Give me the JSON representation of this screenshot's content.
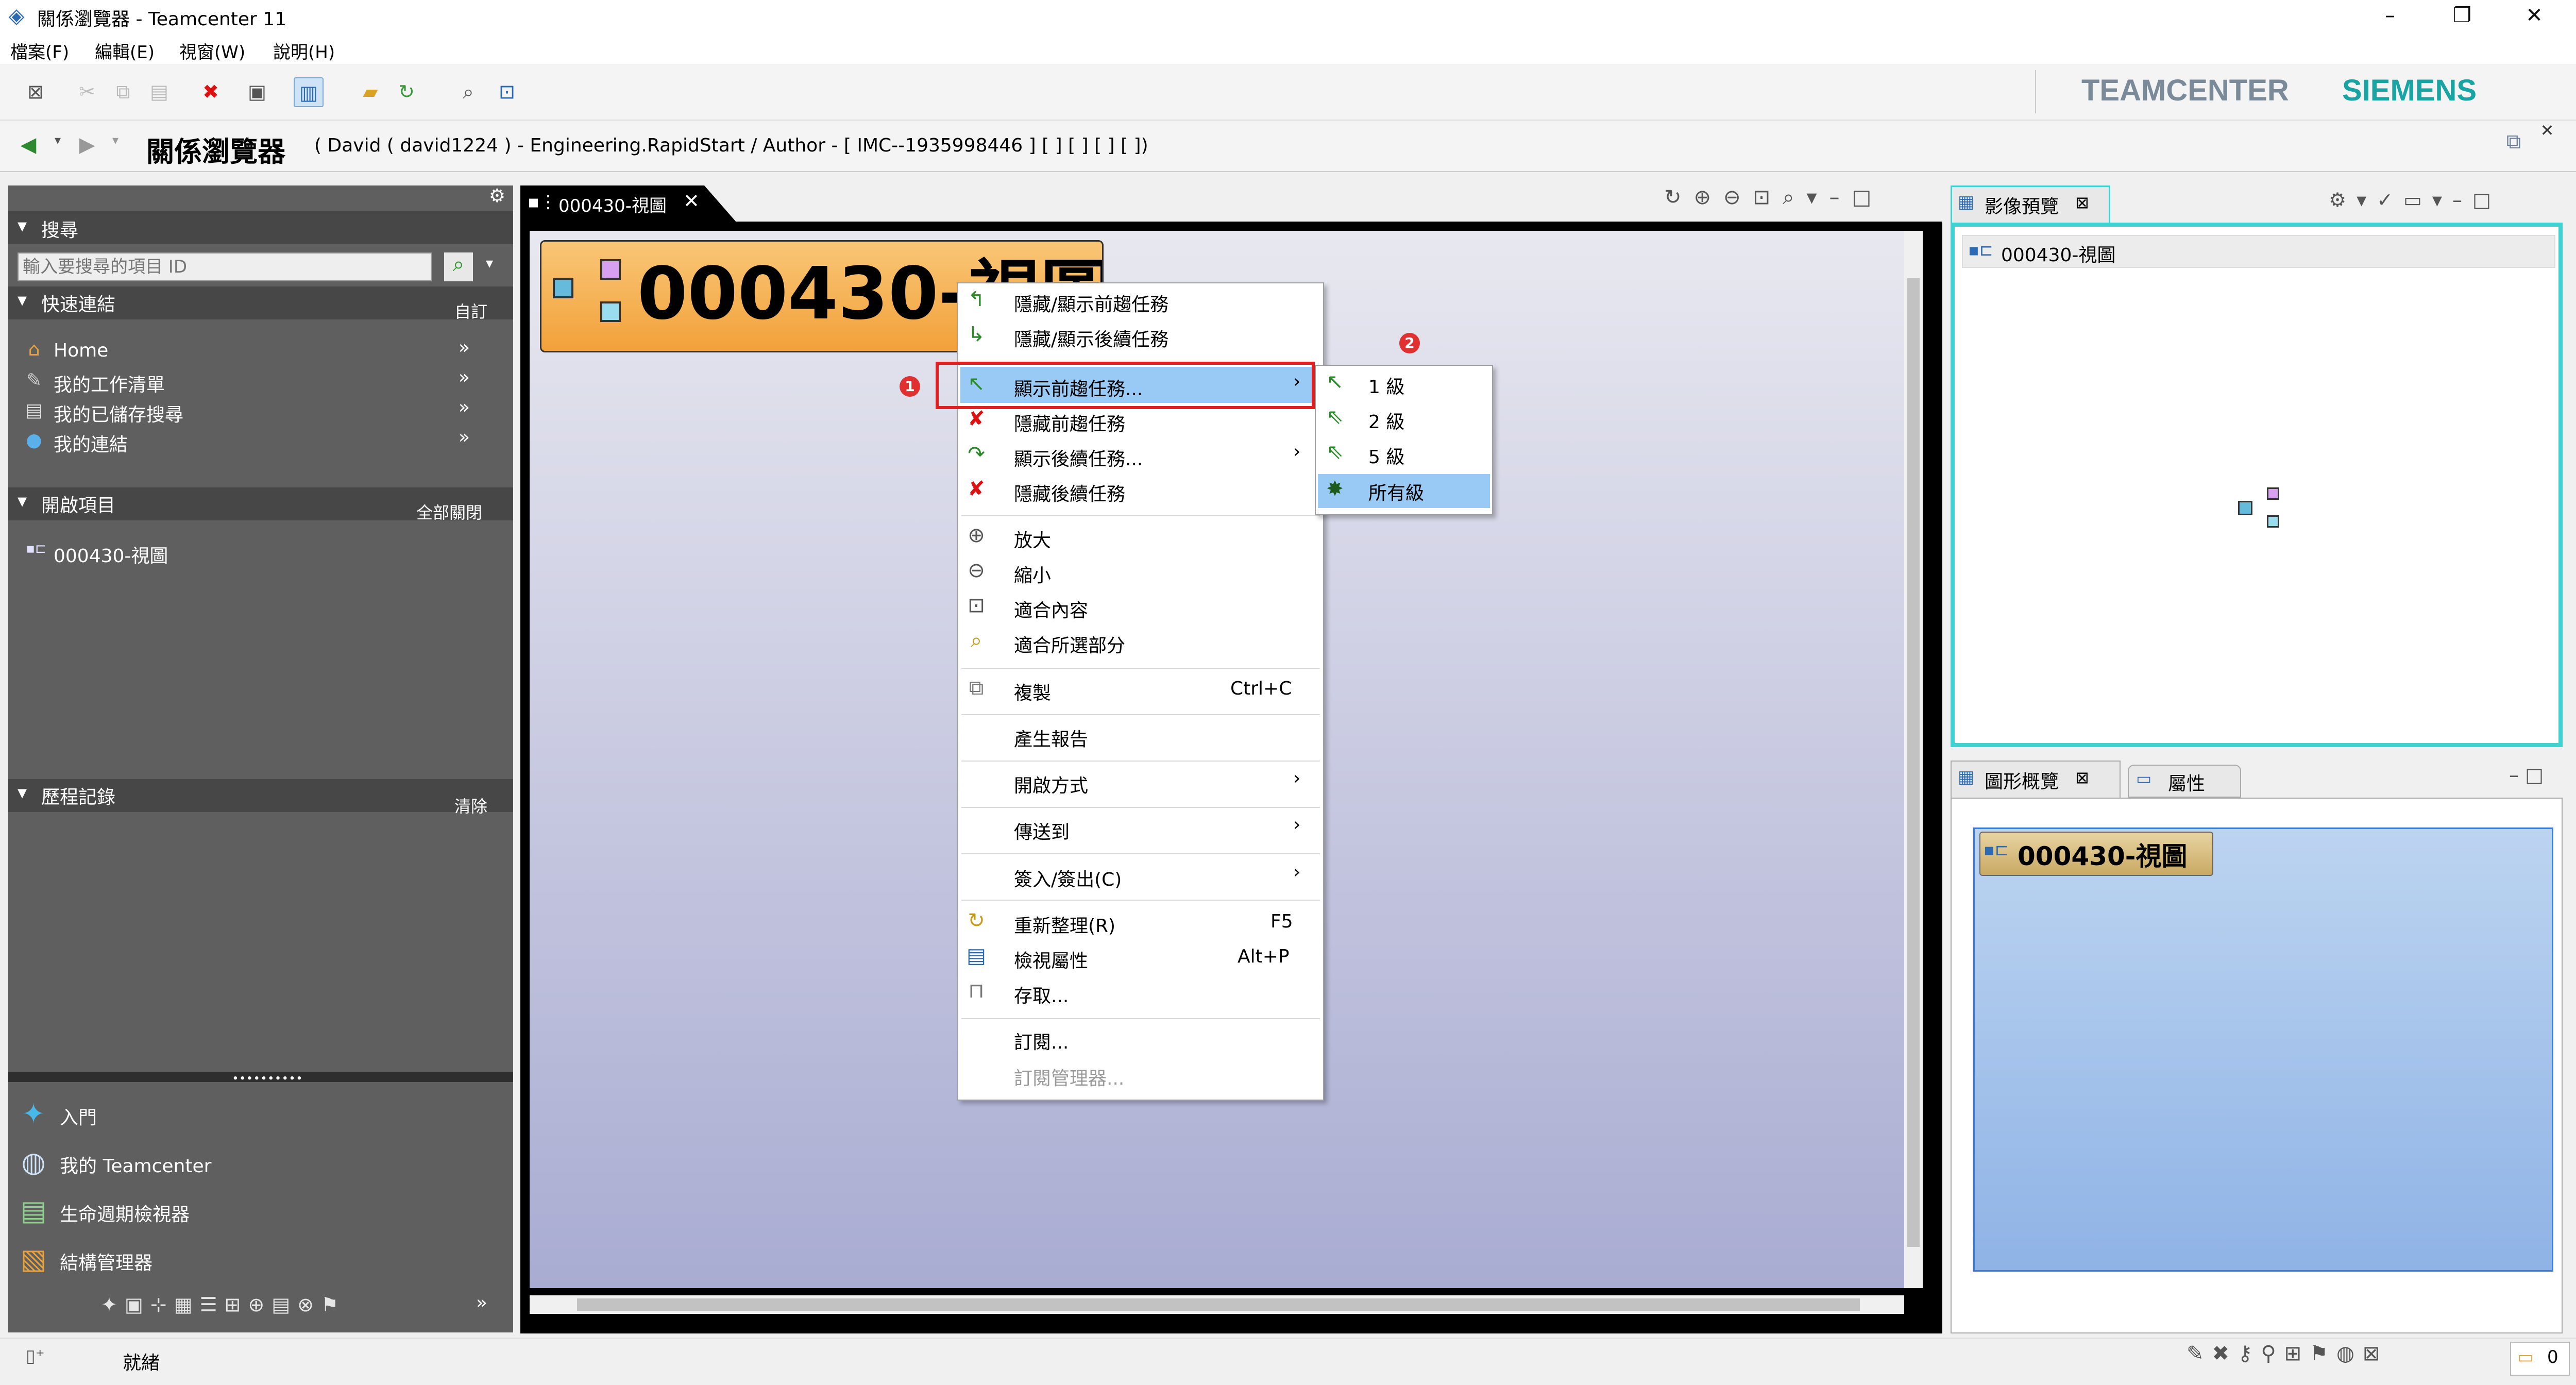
{
  "window": {
    "title": "關係瀏覽器 - Teamcenter 11",
    "minimize": "–",
    "restore": "❐",
    "close": "✕"
  },
  "menu": [
    "檔案(F)",
    "編輯(E)",
    "視窗(W)",
    "說明(H)"
  ],
  "brand": {
    "teamcenter": "TEAMCENTER",
    "siemens": "SIEMENS",
    "teamcenter_color": "#7a8a99",
    "siemens_color": "#1aa3a3"
  },
  "header": {
    "title": "關係瀏覽器",
    "context": "( David ( david1224 ) - Engineering.RapidStart / Author - [ IMC--1935998446 ] [ ] [ ] [ ] [ ])"
  },
  "left": {
    "search": {
      "title": "搜尋",
      "placeholder": "輸入要搜尋的項目 ID"
    },
    "quick": {
      "title": "快速連結",
      "action": "自訂",
      "items": [
        "Home",
        "我的工作清單",
        "我的已儲存搜尋",
        "我的連結"
      ]
    },
    "open": {
      "title": "開啟項目",
      "action": "全部關閉",
      "items": [
        "000430-視圖"
      ]
    },
    "history": {
      "title": "歷程記錄",
      "action": "清除"
    },
    "apps": [
      "入門",
      "我的 Teamcenter",
      "生命週期檢視器",
      "結構管理器"
    ]
  },
  "editor": {
    "tab": "000430-視圖",
    "node_label": "000430-視圖"
  },
  "context_menu": {
    "items": [
      {
        "icon": "hide-show-predecessor-icon",
        "label": "隱藏/顯示前趨任務",
        "shortcut": "",
        "arrow": ""
      },
      {
        "icon": "hide-show-successor-icon",
        "label": "隱藏/顯示後續任務",
        "shortcut": "",
        "arrow": ""
      },
      {
        "icon": "show-predecessor-icon",
        "label": "顯示前趨任務...",
        "shortcut": "",
        "arrow": "›"
      },
      {
        "icon": "hide-predecessor-icon",
        "label": "隱藏前趨任務",
        "shortcut": "",
        "arrow": ""
      },
      {
        "icon": "show-successor-icon",
        "label": "顯示後續任務...",
        "shortcut": "",
        "arrow": "›"
      },
      {
        "icon": "hide-successor-icon",
        "label": "隱藏後續任務",
        "shortcut": "",
        "arrow": ""
      },
      {
        "icon": "zoom-in-icon",
        "label": "放大",
        "shortcut": "",
        "arrow": ""
      },
      {
        "icon": "zoom-out-icon",
        "label": "縮小",
        "shortcut": "",
        "arrow": ""
      },
      {
        "icon": "fit-content-icon",
        "label": "適合內容",
        "shortcut": "",
        "arrow": ""
      },
      {
        "icon": "fit-selection-icon",
        "label": "適合所選部分",
        "shortcut": "",
        "arrow": ""
      },
      {
        "icon": "copy-icon",
        "label": "複製",
        "shortcut": "Ctrl+C",
        "arrow": ""
      },
      {
        "icon": "",
        "label": "產生報告",
        "shortcut": "",
        "arrow": ""
      },
      {
        "icon": "",
        "label": "開啟方式",
        "shortcut": "",
        "arrow": "›"
      },
      {
        "icon": "",
        "label": "傳送到",
        "shortcut": "",
        "arrow": "›"
      },
      {
        "icon": "",
        "label": "簽入/簽出(C)",
        "shortcut": "",
        "arrow": "›"
      },
      {
        "icon": "refresh-icon",
        "label": "重新整理(R)",
        "shortcut": "F5",
        "arrow": ""
      },
      {
        "icon": "properties-icon",
        "label": "檢視屬性",
        "shortcut": "Alt+P",
        "arrow": ""
      },
      {
        "icon": "lock-icon",
        "label": "存取...",
        "shortcut": "",
        "arrow": ""
      },
      {
        "icon": "",
        "label": "訂閱...",
        "shortcut": "",
        "arrow": ""
      },
      {
        "icon": "",
        "label": "訂閱管理器...",
        "shortcut": "",
        "arrow": ""
      }
    ]
  },
  "submenu": {
    "items": [
      "1 級",
      "2 級",
      "5 級",
      "所有級"
    ]
  },
  "badges": [
    "1",
    "2"
  ],
  "right": {
    "preview": {
      "tab": "影像預覽",
      "item": "000430-視圖"
    },
    "overview": {
      "tab": "圖形概覽",
      "tab2": "屬性",
      "node": "000430-視圖"
    }
  },
  "status": {
    "text": "就緒",
    "count": "0"
  },
  "colors": {
    "highlight": "#99c9f5",
    "red_box": "#e02020",
    "accent_teal": "#3fd2d2",
    "node_orange": "#f7b24a"
  }
}
